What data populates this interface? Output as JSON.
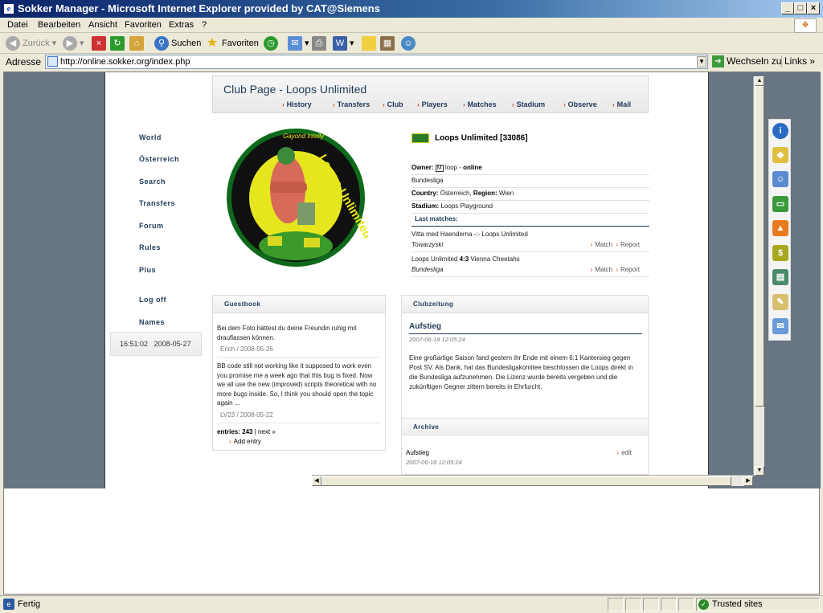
{
  "window": {
    "title": "Sokker Manager - Microsoft Internet Explorer provided by CAT@Siemens"
  },
  "menu": [
    "Datei",
    "Bearbeiten",
    "Ansicht",
    "Favoriten",
    "Extras",
    "?"
  ],
  "toolbar": {
    "back": "Zurück",
    "search": "Suchen",
    "favorites": "Favoriten"
  },
  "address": {
    "label": "Adresse",
    "url": "http://online.sokker.org/index.php",
    "go": "Wechseln zu",
    "links": "Links"
  },
  "header": {
    "title": "Club Page - Loops Unlimited"
  },
  "subnav": [
    "History",
    "Transfers",
    "Club",
    "Players",
    "Matches",
    "Stadium",
    "Observe",
    "Mail"
  ],
  "leftnav": [
    "World",
    "Österreich",
    "Search",
    "Transfers",
    "Forum",
    "Rules",
    "Plus",
    "Log off",
    "Names"
  ],
  "clock": {
    "time": "16:51:02",
    "date": "2008-05-27"
  },
  "logo": {
    "top_text": "Gayond Intelly",
    "ring_text": "Loops Unlimited"
  },
  "club": {
    "name": "Loops Unlimited [33086]",
    "owner_label": "Owner:",
    "owner_badge": "M",
    "owner": "loop",
    "owner_sep": " - ",
    "owner_status": "online",
    "league": "Bundesliga",
    "country_label": "Country:",
    "country": "Österreich,",
    "region_label": "Region:",
    "region": "Wien",
    "stadium_label": "Stadium:",
    "stadium": "Loops Playground",
    "last_matches_label": "Last matches:",
    "matches": [
      {
        "teams": "Vitta med Haenderna -:- Loops Unlimited",
        "league": "Towarzyski",
        "match": "Match",
        "report": "Report"
      },
      {
        "home": "Loops Unlimited",
        "score": "4:3",
        "away": "Vienna Cheetahs",
        "league": "Bundesliga",
        "match": "Match",
        "report": "Report"
      }
    ]
  },
  "guestbook": {
    "title": "Guestbook",
    "entries": [
      {
        "text": "Bei dem Foto hättest du deine Freundin ruhig mit drauflassen können.",
        "meta": "Erich / 2008-05-26"
      },
      {
        "text": "BB code still not working like it supposed to work even you promise me a week ago that this bug is fixed. Now we all use the new (improved) scripts theoretical with no more bugs inside. So, I think you should open the topic again ...",
        "meta": "LV23 / 2008-05-22"
      }
    ],
    "entries_label": "entries:",
    "entries_count": "243",
    "next": "next »",
    "add": "Add entry"
  },
  "clubzeitung": {
    "title": "Clubzeitung",
    "article_title": "Aufstieg",
    "article_date": "2007-06-18 12:05:24",
    "article_text": "Eine großartige Saison fand gestern ihr Ende mit einem 6:1 Kantersieg gegen Post SV. Als Dank, hat das Bundesligakomitee beschlossen die Loops direkt in die Bundesliga aufzunehmen. Die Lizenz wurde bereits vergeben und die zukünftigen Gegner zittern bereits in Ehrfurcht.",
    "archive_title": "Archive",
    "archive_item": "Aufstieg",
    "archive_date": "2007-06-18 12:05:24",
    "archive_edit": "edit"
  },
  "sidebar_icons": [
    "info-icon",
    "shield-icon",
    "players-icon",
    "field-icon",
    "cone-icon",
    "money-icon",
    "book-icon",
    "notepad-icon",
    "mail-icon"
  ],
  "status": {
    "text": "Fertig",
    "zone": "Trusted sites"
  },
  "colors": {
    "title_bar": "#0a246a",
    "page_bg": "#687583",
    "nav_text": "#1f3a57",
    "accent": "#d04010"
  }
}
